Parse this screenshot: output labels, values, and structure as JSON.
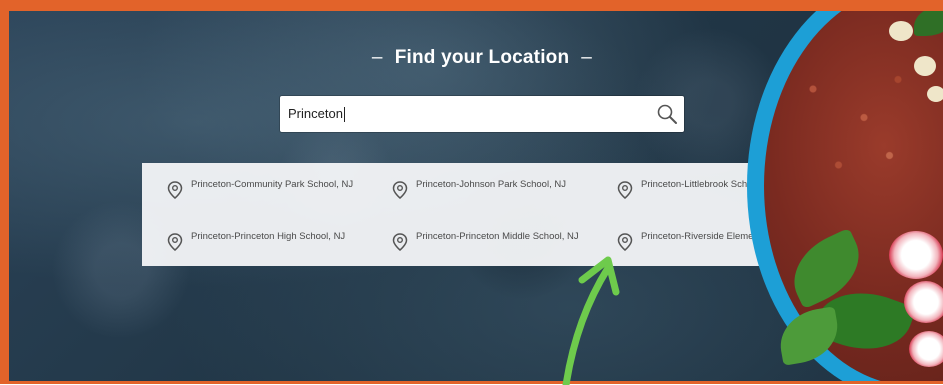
{
  "header": {
    "title": "Find your Location",
    "dash": "–"
  },
  "search": {
    "value": "Princeton"
  },
  "results": [
    {
      "label": "Princeton-Community Park School, NJ"
    },
    {
      "label": "Princeton-Johnson Park School, NJ"
    },
    {
      "label": "Princeton-Littlebrook School, NJ"
    },
    {
      "label": "Princeton-Princeton High School, NJ"
    },
    {
      "label": "Princeton-Princeton Middle School, NJ"
    },
    {
      "label": "Princeton-Riverside Elementary School, NJ"
    }
  ],
  "icons": {
    "search": "magnifier-icon",
    "result": "location-pin-icon",
    "annotation": "green-arrow-icon"
  },
  "colors": {
    "frame": "#e2632a",
    "background": "#213646",
    "arrow": "#6ecb4c",
    "bowl": "#1d9fd6"
  }
}
